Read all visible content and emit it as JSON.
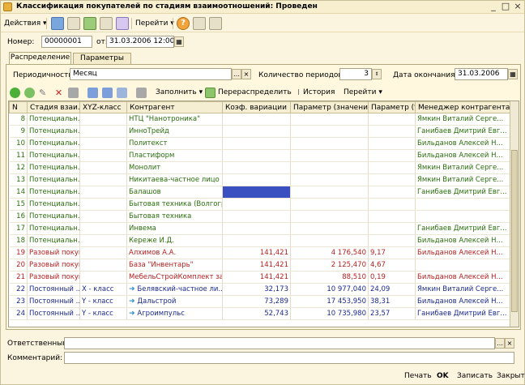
{
  "window": {
    "title": "Классификация покупателей по стадиям взаимоотношений: Проведен",
    "controls": [
      "_",
      "□",
      "×"
    ]
  },
  "toolbar": {
    "actions_label": "Действия ▾",
    "goto_label": "Перейти ▾",
    "help_icon": "?"
  },
  "header": {
    "number_label": "Номер:",
    "number_value": "00000001",
    "date_label": "от:",
    "date_value": "31.03.2006 12:00:00"
  },
  "tabs": [
    {
      "label": "Распределение",
      "active": true
    },
    {
      "label": "Параметры",
      "active": false
    }
  ],
  "params": {
    "periodicity_label": "Периодичность:",
    "periodicity_value": "Месяц",
    "periods_count_label": "Количество периодов:",
    "periods_count_value": "3",
    "end_date_label": "Дата окончания:",
    "end_date_value": "31.03.2006"
  },
  "grid_toolbar": {
    "fill_label": "Заполнить ▾",
    "redistribute_label": "Перераспределить",
    "history_label": "История",
    "goto_label": "Перейти ▾"
  },
  "grid": {
    "columns": [
      "N",
      "Стадия взаи...",
      "XYZ-класс",
      "Контрагент",
      "Коэф. вариации",
      "Параметр (значение)",
      "Параметр (%)",
      "Менеджер контрагента"
    ],
    "rows": [
      {
        "n": "8",
        "stage": "Потенциальн...",
        "xyz": "",
        "contractor": "НТЦ \"Нанотроника\"",
        "coef": "",
        "value": "",
        "pct": "",
        "manager": "Ямкин Виталий Серге...",
        "color": "green"
      },
      {
        "n": "9",
        "stage": "Потенциальн...",
        "xyz": "",
        "contractor": "ИнноТрейд",
        "coef": "",
        "value": "",
        "pct": "",
        "manager": "Ганибаев Дмитрий Евг...",
        "color": "green"
      },
      {
        "n": "10",
        "stage": "Потенциальн...",
        "xyz": "",
        "contractor": "Политекст",
        "coef": "",
        "value": "",
        "pct": "",
        "manager": "Бильданов Алексей Н...",
        "color": "green"
      },
      {
        "n": "11",
        "stage": "Потенциальн...",
        "xyz": "",
        "contractor": "Пластиформ",
        "coef": "",
        "value": "",
        "pct": "",
        "manager": "Бильданов Алексей Н...",
        "color": "green"
      },
      {
        "n": "12",
        "stage": "Потенциальн...",
        "xyz": "",
        "contractor": "Монолит",
        "coef": "",
        "value": "",
        "pct": "",
        "manager": "Ямкин Виталий Серге...",
        "color": "green"
      },
      {
        "n": "13",
        "stage": "Потенциальн...",
        "xyz": "",
        "contractor": "Никитаева-частное лицо",
        "coef": "",
        "value": "",
        "pct": "",
        "manager": "Ямкин Виталий Серге...",
        "color": "green"
      },
      {
        "n": "14",
        "stage": "Потенциальн...",
        "xyz": "",
        "contractor": "Балашов",
        "coef": "",
        "value": "",
        "pct": "",
        "manager": "Ганибаев Дмитрий Евг...",
        "color": "green",
        "selected": true
      },
      {
        "n": "15",
        "stage": "Потенциальн...",
        "xyz": "",
        "contractor": "Бытовая техника (Волгогр...",
        "coef": "",
        "value": "",
        "pct": "",
        "manager": "",
        "color": "green"
      },
      {
        "n": "16",
        "stage": "Потенциальн...",
        "xyz": "",
        "contractor": "Бытовая техника",
        "coef": "",
        "value": "",
        "pct": "",
        "manager": "",
        "color": "green"
      },
      {
        "n": "17",
        "stage": "Потенциальн...",
        "xyz": "",
        "contractor": "Инвема",
        "coef": "",
        "value": "",
        "pct": "",
        "manager": "Ганибаев Дмитрий Евг...",
        "color": "green"
      },
      {
        "n": "18",
        "stage": "Потенциальн...",
        "xyz": "",
        "contractor": "Кереже И.Д.",
        "coef": "",
        "value": "",
        "pct": "",
        "manager": "Бильданов Алексей Н...",
        "color": "green"
      },
      {
        "n": "19",
        "stage": "Разовый покуп...",
        "xyz": "",
        "contractor": "Алхимов А.А.",
        "coef": "141,421",
        "value": "4 176,540",
        "pct": "9,17",
        "manager": "Бильданов Алексей Н...",
        "color": "red"
      },
      {
        "n": "20",
        "stage": "Разовый покуп...",
        "xyz": "",
        "contractor": "База \"Инвентарь\"",
        "coef": "141,421",
        "value": "2 125,470",
        "pct": "4,67",
        "manager": "",
        "color": "red"
      },
      {
        "n": "21",
        "stage": "Разовый покуп...",
        "xyz": "",
        "contractor": "МебельСтройКомплект за...",
        "coef": "141,421",
        "value": "88,510",
        "pct": "0,19",
        "manager": "Бильданов Алексей Н...",
        "color": "red"
      },
      {
        "n": "22",
        "stage": "Постоянный ...",
        "xyz": "X - класс",
        "contractor": "Белявский-частное ли...",
        "coef": "32,173",
        "value": "10 977,040",
        "pct": "24,09",
        "manager": "Ямкин Виталий Серге...",
        "color": "blue",
        "arrow": true
      },
      {
        "n": "23",
        "stage": "Постоянный ...",
        "xyz": "Y - класс",
        "contractor": "Дальстрой",
        "coef": "73,289",
        "value": "17 453,950",
        "pct": "38,31",
        "manager": "Бильданов Алексей Н...",
        "color": "blue",
        "arrow": true
      },
      {
        "n": "24",
        "stage": "Постоянный ...",
        "xyz": "Y - класс",
        "contractor": "Агроимпульс",
        "coef": "52,743",
        "value": "10 735,980",
        "pct": "23,57",
        "manager": "Ганибаев Дмитрий Евг...",
        "color": "blue",
        "arrow": true
      }
    ]
  },
  "footer": {
    "responsible_label": "Ответственный:",
    "responsible_value": "",
    "comment_label": "Комментарий:",
    "comment_value": "",
    "print_label": "Печать",
    "ok_label": "OK",
    "save_label": "Записать",
    "close_label": "Закрыть"
  }
}
